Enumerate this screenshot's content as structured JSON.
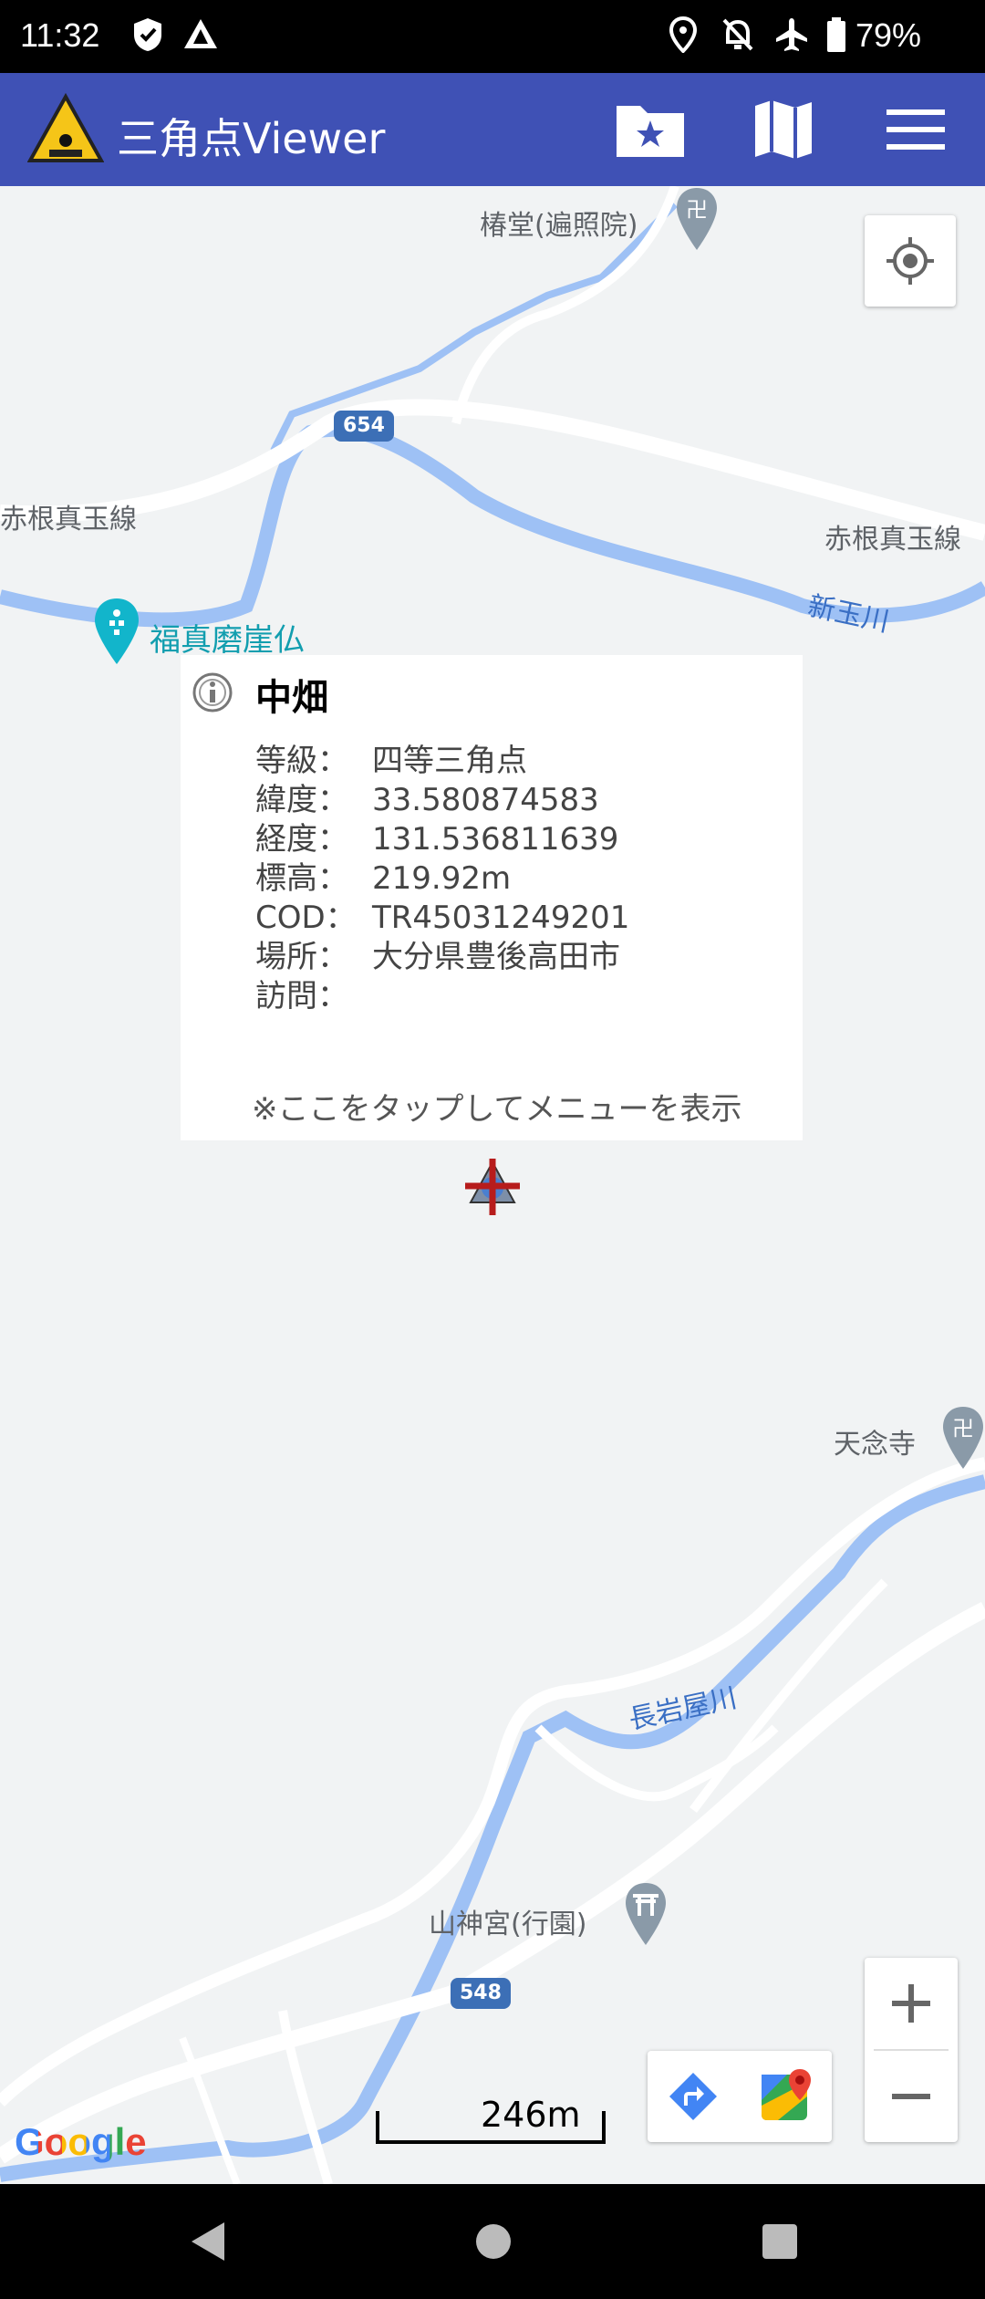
{
  "status_bar": {
    "time": "11:32",
    "battery_percent": "79%",
    "icons": [
      "shield-check-icon",
      "triangle-icon",
      "location-icon",
      "alarm-off-icon",
      "airplane-icon",
      "battery-icon"
    ]
  },
  "app_bar": {
    "title": "三角点Viewer",
    "color": "#3f51b5",
    "icons": [
      "app-logo-icon",
      "favorites-folder-icon",
      "map-icon",
      "menu-icon"
    ]
  },
  "map": {
    "labels": {
      "temple_top": "椿堂(遍照院)",
      "road_left": "赤根真玉線",
      "road_right": "赤根真玉線",
      "river_top": "新玉川",
      "poi_teal": "福真磨崖仏",
      "temple_right": "天念寺",
      "river_bottom": "長岩屋川",
      "shrine": "山神宮(行園)"
    },
    "route_numbers": [
      "654",
      "548"
    ],
    "scale": "246m",
    "attribution": "Google"
  },
  "info_window": {
    "title": "中畑",
    "rows": [
      {
        "key": "等級：",
        "value": "四等三角点"
      },
      {
        "key": "緯度：",
        "value": "33.580874583"
      },
      {
        "key": "経度：",
        "value": "131.536811639"
      },
      {
        "key": "標高：",
        "value": "219.92m"
      },
      {
        "key": "COD：",
        "value": "TR45031249201"
      },
      {
        "key": "場所：",
        "value": "大分県豊後高田市"
      },
      {
        "key": "訪問：",
        "value": ""
      }
    ],
    "hint": "※ここをタップしてメニューを表示"
  },
  "controls": {
    "zoom_in": "+",
    "zoom_out": "−"
  },
  "colors": {
    "map_bg": "#f1f3f4",
    "road": "#ffffff",
    "water": "#9ec1f5",
    "marker_cross": "#b71c1c"
  }
}
